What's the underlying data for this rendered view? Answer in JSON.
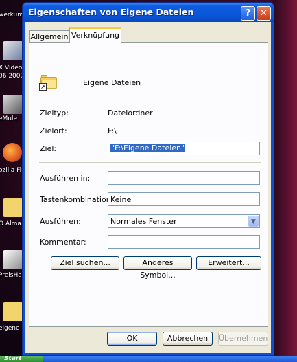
{
  "window": {
    "title": "Eigenschaften von Eigene Dateien",
    "help_glyph": "?",
    "close_glyph": "✕"
  },
  "tabs": [
    {
      "label": "Allgemein"
    },
    {
      "label": "Verknüpfung",
      "active": true
    }
  ],
  "shortcut": {
    "name": "Eigene Dateien",
    "zieltyp_label": "Zieltyp:",
    "zieltyp_value": "Dateiordner",
    "zielort_label": "Zielort:",
    "zielort_value": "F:\\",
    "ziel_label": "Ziel:",
    "ziel_value": "\"F:\\Eigene Dateien\"",
    "ausfuehren_in_label": "Ausführen in:",
    "ausfuehren_in_value": "",
    "tastenkombination_label": "Tastenkombination:",
    "tastenkombination_value": "Keine",
    "ausfuehren_label": "Ausführen:",
    "ausfuehren_value": "Normales Fenster",
    "kommentar_label": "Kommentar:",
    "kommentar_value": ""
  },
  "buttons": {
    "ziel_suchen": "Ziel suchen...",
    "anderes_symbol": "Anderes Symbol...",
    "erweitert": "Erweitert...",
    "ok": "OK",
    "abbrechen": "Abbrechen",
    "uebernehmen": "Übernehmen"
  },
  "desktop_icons": [
    {
      "label": "werkum"
    },
    {
      "label": "X Video"
    },
    {
      "label": "06 2007"
    },
    {
      "label": "eMule"
    },
    {
      "label": "ozilla Fir"
    },
    {
      "label": "O Alma"
    },
    {
      "label": "PreisHa"
    },
    {
      "label": "eigene Da"
    }
  ],
  "taskbar": {
    "start_label": "Start"
  },
  "colors": {
    "titlebar": "#0a55d8",
    "selection": "#316ac5",
    "dialog_bg": "#ece9d8"
  }
}
